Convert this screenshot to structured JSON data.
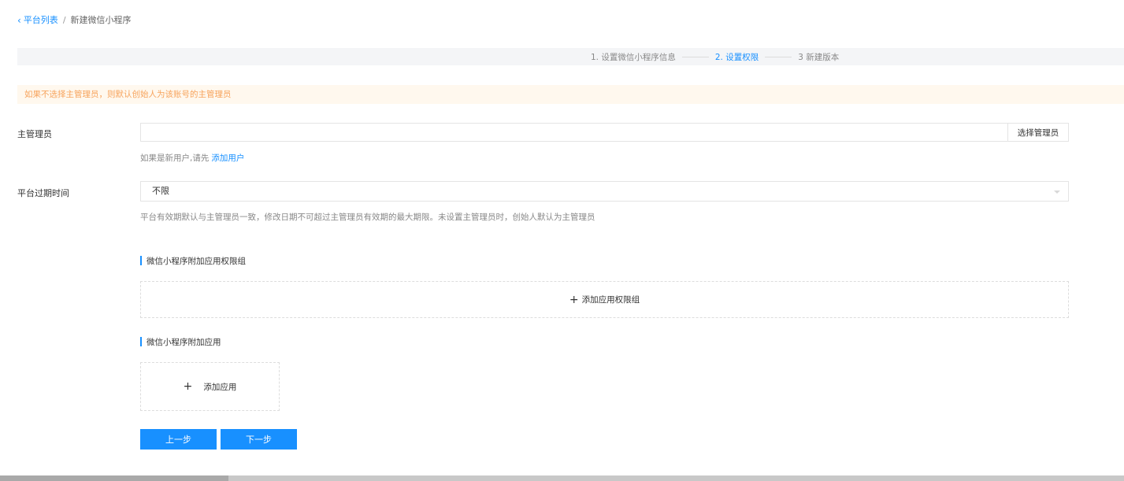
{
  "breadcrumb": {
    "back_label": "平台列表",
    "separator": "/",
    "current": "新建微信小程序"
  },
  "steps": [
    {
      "label": "1. 设置微信小程序信息",
      "active": false
    },
    {
      "label": "2. 设置权限",
      "active": true
    },
    {
      "label": "3 新建版本",
      "active": false
    }
  ],
  "warning": "如果不选择主管理员，则默认创始人为该账号的主管理员",
  "admin": {
    "label": "主管理员",
    "value": "",
    "select_button": "选择管理员",
    "hint_prefix": "如果是新用户,请先",
    "hint_link": "添加用户"
  },
  "expiry": {
    "label": "平台过期时间",
    "selected": "不限",
    "hint": "平台有效期默认与主管理员一致，修改日期不可超过主管理员有效期的最大期限。未设置主管理员时，创始人默认为主管理员"
  },
  "permission_group": {
    "title": "微信小程序附加应用权限组",
    "add_label": "添加应用权限组"
  },
  "apps": {
    "title": "微信小程序附加应用",
    "add_label": "添加应用"
  },
  "buttons": {
    "prev": "上一步",
    "next": "下一步"
  },
  "colors": {
    "primary": "#1890ff",
    "warning_text": "#f7a35c",
    "warning_bg": "#fff8ee"
  }
}
